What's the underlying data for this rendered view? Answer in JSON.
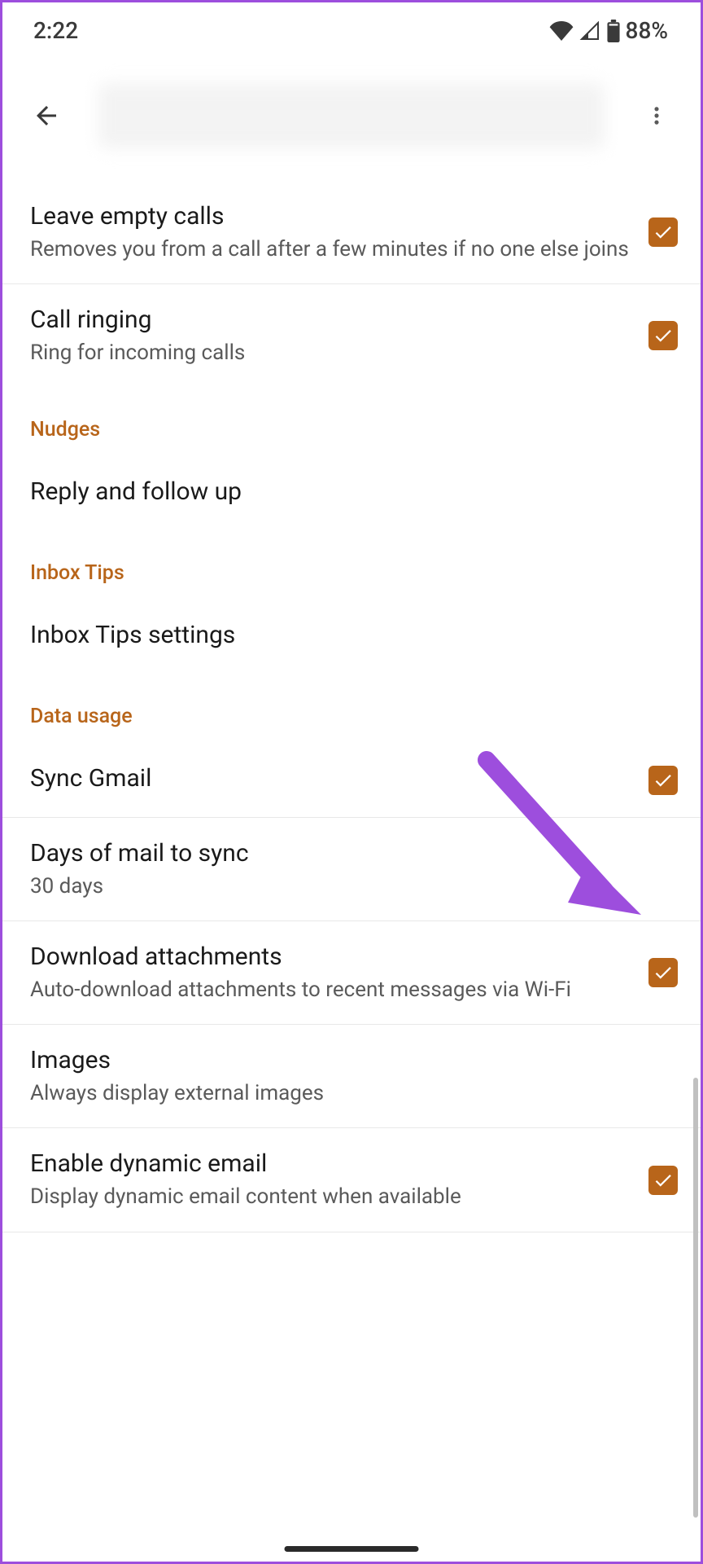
{
  "status": {
    "time": "2:22",
    "battery": "88%"
  },
  "settings": {
    "leave_empty_calls": {
      "title": "Leave empty calls",
      "subtitle": "Removes you from a call after a few minutes if no one else joins",
      "checked": true
    },
    "call_ringing": {
      "title": "Call ringing",
      "subtitle": "Ring for incoming calls",
      "checked": true
    },
    "nudges_header": "Nudges",
    "reply_follow": {
      "title": "Reply and follow up"
    },
    "inbox_tips_header": "Inbox Tips",
    "inbox_tips": {
      "title": "Inbox Tips settings"
    },
    "data_usage_header": "Data usage",
    "sync_gmail": {
      "title": "Sync Gmail",
      "checked": true
    },
    "days_sync": {
      "title": "Days of mail to sync",
      "subtitle": "30 days"
    },
    "download_attachments": {
      "title": "Download attachments",
      "subtitle": "Auto-download attachments to recent messages via Wi-Fi",
      "checked": true
    },
    "images": {
      "title": "Images",
      "subtitle": "Always display external images"
    },
    "dynamic_email": {
      "title": "Enable dynamic email",
      "subtitle": "Display dynamic email content when available",
      "checked": true
    }
  }
}
